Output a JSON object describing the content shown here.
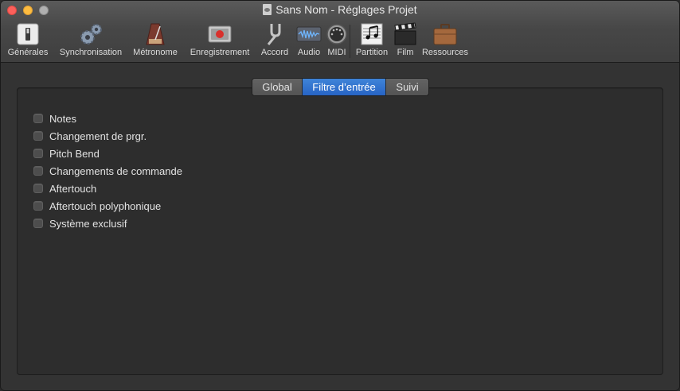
{
  "window": {
    "title": "Sans Nom - Réglages Projet"
  },
  "toolbar": {
    "items": [
      {
        "label": "Générales",
        "icon": "switch-icon"
      },
      {
        "label": "Synchronisation",
        "icon": "gears-icon"
      },
      {
        "label": "Métronome",
        "icon": "metronome-icon"
      },
      {
        "label": "Enregistrement",
        "icon": "record-icon"
      },
      {
        "label": "Accord",
        "icon": "tuning-fork-icon"
      },
      {
        "label": "Audio",
        "icon": "waveform-icon"
      },
      {
        "label": "MIDI",
        "icon": "midi-port-icon"
      },
      {
        "label": "Partition",
        "icon": "score-icon"
      },
      {
        "label": "Film",
        "icon": "clapper-icon"
      },
      {
        "label": "Ressources",
        "icon": "briefcase-icon"
      }
    ]
  },
  "tabs": [
    {
      "label": "Global"
    },
    {
      "label": "Filtre d’entrée"
    },
    {
      "label": "Suivi"
    }
  ],
  "active_tab": "Filtre d’entrée",
  "filters": [
    {
      "label": "Notes",
      "checked": false
    },
    {
      "label": "Changement de prgr.",
      "checked": false
    },
    {
      "label": "Pitch Bend",
      "checked": false
    },
    {
      "label": "Changements de commande",
      "checked": false
    },
    {
      "label": "Aftertouch",
      "checked": false
    },
    {
      "label": "Aftertouch polyphonique",
      "checked": false
    },
    {
      "label": "Système exclusif",
      "checked": false
    }
  ],
  "colors": {
    "accent": "#2f6fd0",
    "background": "#333333",
    "record_red": "#d9302c"
  }
}
